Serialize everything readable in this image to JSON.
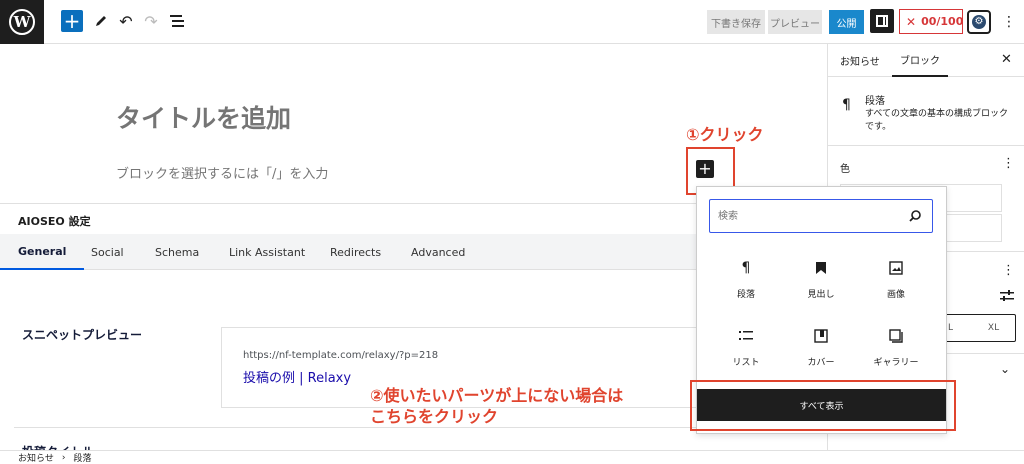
{
  "toolbar": {
    "wp_logo": "W",
    "add_block": "+",
    "save_draft": "下書き保存",
    "preview": "プレビュー",
    "publish": "公開",
    "aioseo_score": "00/100"
  },
  "editor": {
    "title_placeholder": "タイトルを追加",
    "block_placeholder": "ブロックを選択するには「/」を入力",
    "inline_add": "+"
  },
  "aioseo": {
    "header": "AIOSEO 設定",
    "tabs": [
      "General",
      "Social",
      "Schema",
      "Link Assistant",
      "Redirects",
      "Advanced"
    ],
    "snippet_label": "スニペットプレビュー",
    "snippet_url": "https://nf-template.com/relaxy/?p=218",
    "snippet_title": "投稿の例 | Relaxy",
    "next_label": "投稿タイトル"
  },
  "sidebar": {
    "tabs": [
      "お知らせ",
      "ブロック"
    ],
    "block_name": "段落",
    "block_desc": "すべての文章の基本の構成ブロックです。",
    "color_title": "色",
    "size_options": [
      "L",
      "XL"
    ]
  },
  "inserter": {
    "search_placeholder": "検索",
    "items": [
      {
        "label": "段落",
        "icon": "paragraph-icon"
      },
      {
        "label": "見出し",
        "icon": "bookmark-icon"
      },
      {
        "label": "画像",
        "icon": "image-icon"
      },
      {
        "label": "リスト",
        "icon": "list-icon"
      },
      {
        "label": "カバー",
        "icon": "cover-icon"
      },
      {
        "label": "ギャラリー",
        "icon": "gallery-icon"
      }
    ],
    "show_all": "すべて表示"
  },
  "annotations": {
    "step1": "①クリック",
    "step2_line1": "②使いたいパーツが上にない場合は",
    "step2_line2": "こちらをクリック"
  },
  "footer": {
    "crumbs": [
      "お知らせ",
      "段落"
    ]
  },
  "colors": {
    "accent": "#0a6fbd",
    "publish": "#1a88cc",
    "annotation": "#e0442e",
    "aioseo_red": "#d63638",
    "search_focus": "#3858e9"
  }
}
